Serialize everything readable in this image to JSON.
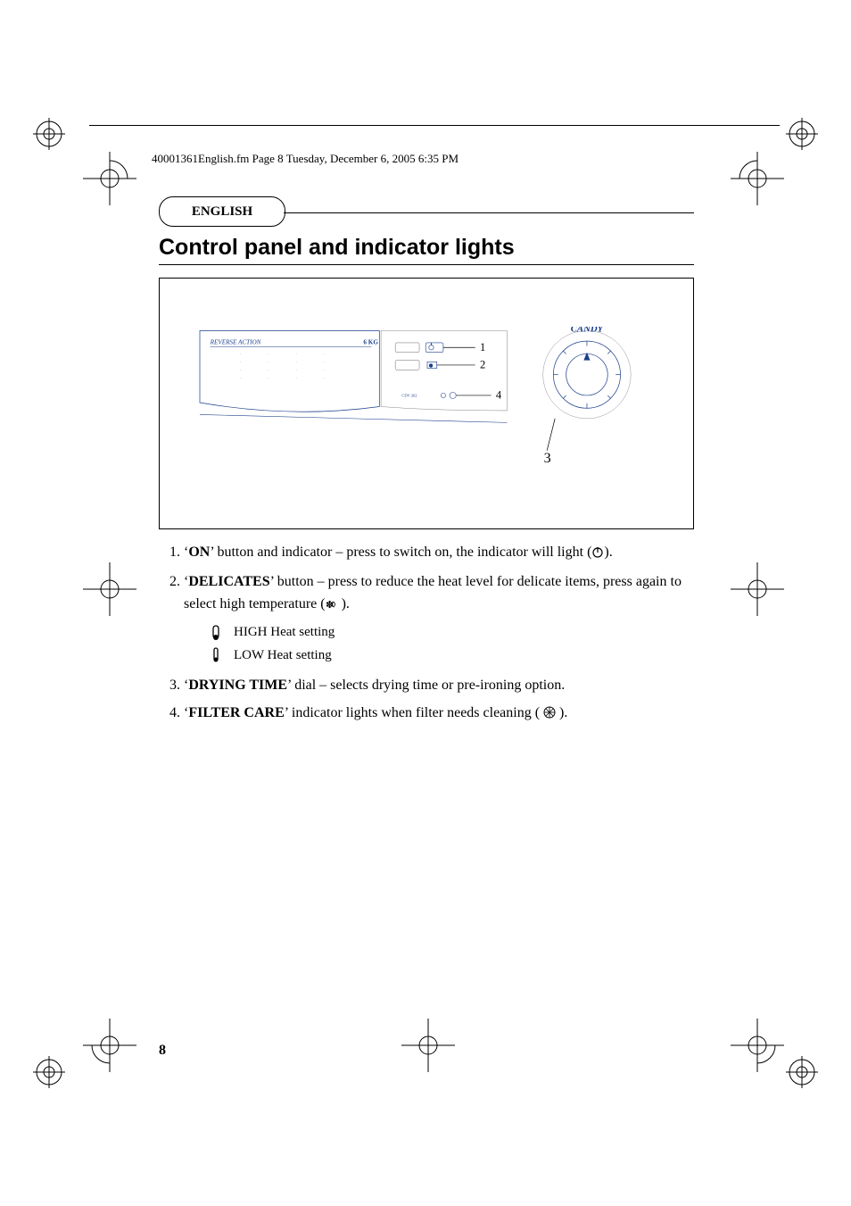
{
  "header_line": "40001361English.fm  Page 8  Tuesday, December 6, 2005  6:35 PM",
  "language_label": "ENGLISH",
  "title": "Control panel and indicator lights",
  "diagram": {
    "brand": "CANDY",
    "panel_text": "REVERSE ACTION",
    "weight_label": "6 KG",
    "model_label": "CDV 262",
    "callouts": [
      "1",
      "2",
      "3",
      "4"
    ]
  },
  "items": [
    {
      "num": "1.",
      "lead": "‘",
      "bold": "ON",
      "rest": "’ button and indicator – press to switch on, the indicator will light (  ).",
      "icon": "power"
    },
    {
      "num": "2.",
      "lead": "‘",
      "bold": "DELICATES",
      "rest": "’ button – press to reduce the heat level for delicate items, press again to select high temperature (   ).",
      "icon": "heat"
    },
    {
      "num": "3.",
      "lead": "‘",
      "bold": "DRYING TIME",
      "rest": "’ dial – selects drying time or pre-ironing option."
    },
    {
      "num": "4.",
      "lead": "‘",
      "bold": "FILTER CARE",
      "rest": "’ indicator lights when filter needs cleaning (     ).",
      "icon": "filter"
    }
  ],
  "heat_settings": {
    "high": "HIGH Heat setting",
    "low": "LOW Heat setting"
  },
  "page_number": "8"
}
